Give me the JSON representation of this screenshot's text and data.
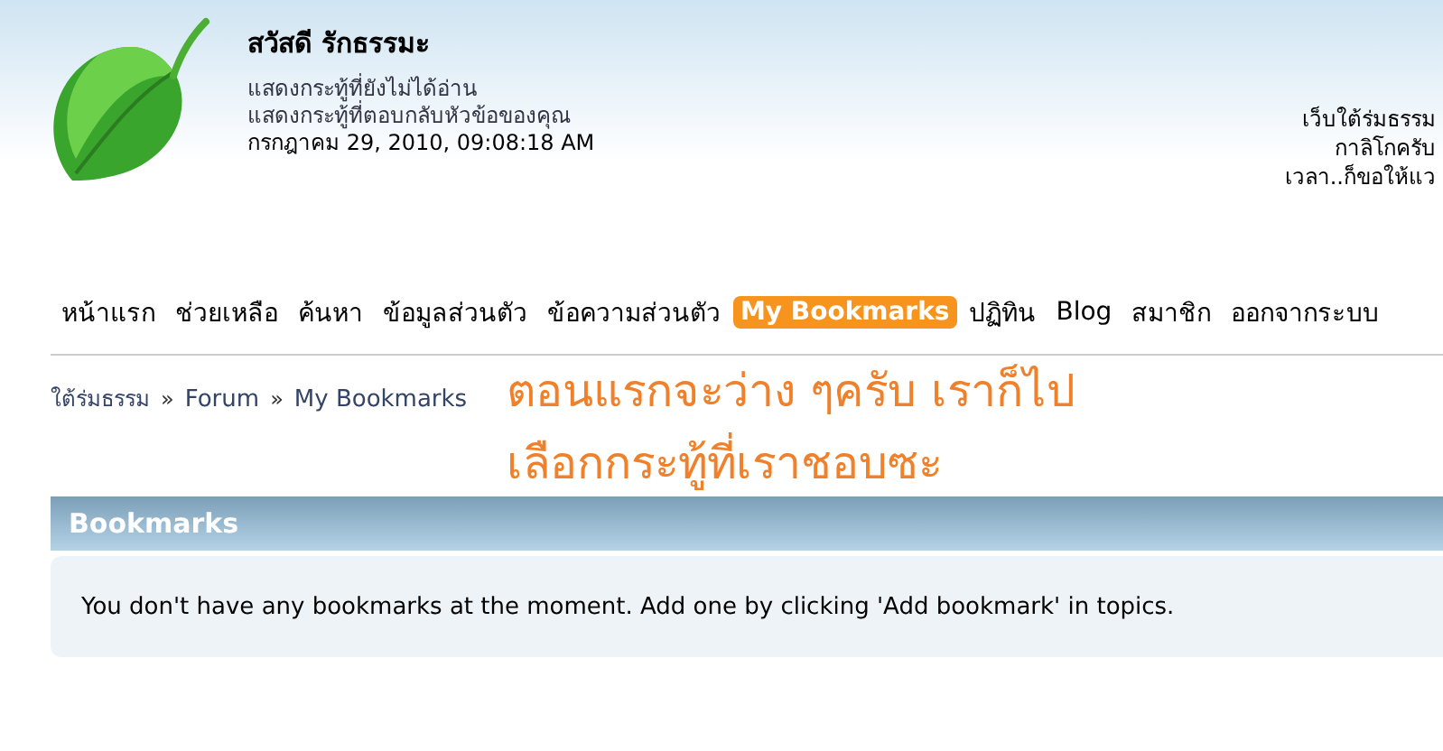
{
  "user": {
    "greeting": "สวัสดี รักธรรมะ",
    "links": [
      "แสดงกระทู้ที่ยังไม่ได้อ่าน",
      "แสดงกระทู้ที่ตอบกลับหัวข้อของคุณ"
    ],
    "datetime": "กรกฎาคม 29, 2010, 09:08:18 AM"
  },
  "news": [
    "เว็บใต้ร่มธรรม",
    "กาลิโกครับ",
    "เวลา..ก็ขอให้แว"
  ],
  "nav": [
    {
      "label": "หน้าแรก",
      "selected": false
    },
    {
      "label": "ช่วยเหลือ",
      "selected": false
    },
    {
      "label": "ค้นหา",
      "selected": false
    },
    {
      "label": "ข้อมูลส่วนตัว",
      "selected": false
    },
    {
      "label": "ข้อความส่วนตัว",
      "selected": false
    },
    {
      "label": "My Bookmarks",
      "selected": true
    },
    {
      "label": "ปฏิทิน",
      "selected": false
    },
    {
      "label": "Blog",
      "selected": false
    },
    {
      "label": "สมาชิก",
      "selected": false
    },
    {
      "label": "ออกจากระบบ",
      "selected": false
    }
  ],
  "breadcrumb": [
    "ใต้ร่มธรรม",
    "Forum",
    "My Bookmarks"
  ],
  "breadcrumb_separator": "»",
  "annotation": [
    "ตอนแรกจะว่าง ๆครับ เราก็ไป",
    "เลือกกระทู้ที่เราชอบซะ"
  ],
  "panel": {
    "title": "Bookmarks",
    "message": "You don't have any bookmarks at the moment. Add one by clicking 'Add bookmark' in topics."
  }
}
